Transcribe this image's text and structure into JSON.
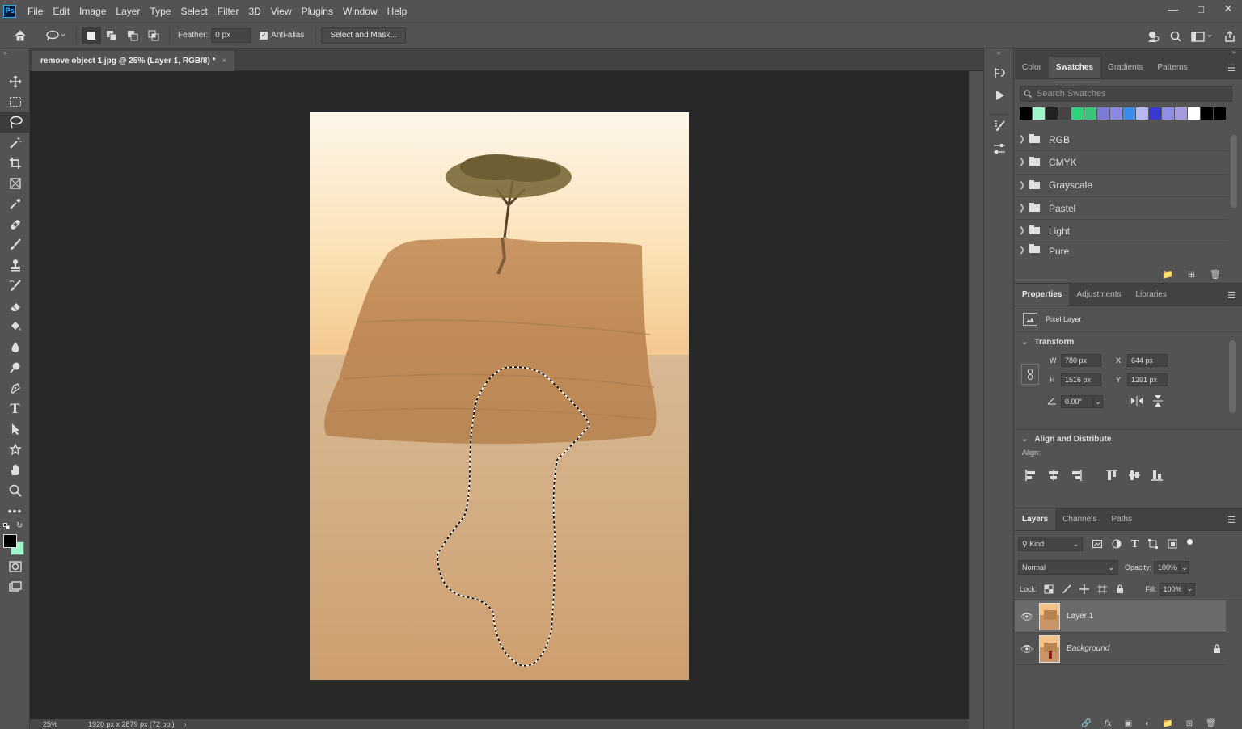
{
  "app": {
    "logo": "Ps",
    "menu": [
      "File",
      "Edit",
      "Image",
      "Layer",
      "Type",
      "Select",
      "Filter",
      "3D",
      "View",
      "Plugins",
      "Window",
      "Help"
    ]
  },
  "options_bar": {
    "feather_label": "Feather:",
    "feather_value": "0 px",
    "antialias_label": "Anti-alias",
    "select_mask_label": "Select and Mask..."
  },
  "document": {
    "tab_title": "remove object 1.jpg @ 25% (Layer 1, RGB/8) *",
    "close_glyph": "×"
  },
  "status_bar": {
    "zoom": "25%",
    "doc_info": "1920 px x 2879 px (72 ppi)"
  },
  "swatches_panel": {
    "tabs": [
      "Color",
      "Swatches",
      "Gradients",
      "Patterns"
    ],
    "active_tab": "Swatches",
    "search_placeholder": "Search Swatches",
    "recent_colors": [
      "#000000",
      "#9ef5c8",
      "#222222",
      "#444444",
      "#2ed37a",
      "#3ac47a",
      "#7b7bd6",
      "#8a8ae0",
      "#3b8be8",
      "#b8b8f0",
      "#3a3ad0",
      "#8f8fe6",
      "#a49ae0",
      "#ffffff",
      "#000000",
      "#000000"
    ],
    "groups": [
      "RGB",
      "CMYK",
      "Grayscale",
      "Pastel",
      "Light",
      "Pure"
    ]
  },
  "properties_panel": {
    "tabs": [
      "Properties",
      "Adjustments",
      "Libraries"
    ],
    "active_tab": "Properties",
    "type_label": "Pixel Layer",
    "transform_label": "Transform",
    "w_label": "W",
    "w_value": "780 px",
    "h_label": "H",
    "h_value": "1516 px",
    "x_label": "X",
    "x_value": "644 px",
    "y_label": "Y",
    "y_value": "1291 px",
    "angle_value": "0.00°",
    "align_label": "Align and Distribute",
    "align_sub": "Align:"
  },
  "layers_panel": {
    "tabs": [
      "Layers",
      "Channels",
      "Paths"
    ],
    "active_tab": "Layers",
    "kind_label": "Kind",
    "blend_mode": "Normal",
    "opacity_label": "Opacity:",
    "opacity_value": "100%",
    "lock_label": "Lock:",
    "fill_label": "Fill:",
    "fill_value": "100%",
    "layers": [
      {
        "name": "Layer 1",
        "selected": true
      },
      {
        "name": "Background",
        "selected": false
      }
    ]
  },
  "colors": {
    "foreground": "#000000",
    "background": "#9ef5c8",
    "accent": "#31a8ff"
  }
}
